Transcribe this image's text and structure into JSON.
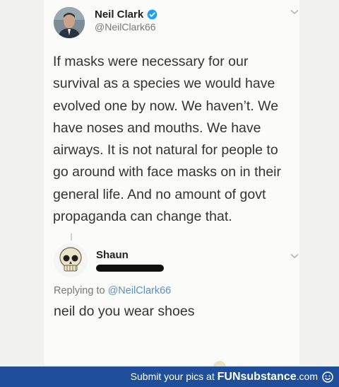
{
  "tweet": {
    "author_name": "Neil Clark",
    "author_handle": "@NeilClark66",
    "verified_icon": "verified-badge-icon",
    "menu_icon": "chevron-down-icon",
    "lines": [
      "If masks were necessary for our",
      "survival as a species we would have",
      "evolved one by now. We haven’t. We",
      "have noses and mouths. We have",
      "airways. It is not natural for people to",
      "go around with face masks on in their",
      "general life. And no amount of govt",
      "propaganda can change that."
    ]
  },
  "reply": {
    "author_name": "Shaun",
    "handle_redacted": true,
    "replying_prefix": "Replying to",
    "replying_mention": "@NeilClark66",
    "text": "neil do you wear shoes",
    "menu_icon": "chevron-down-icon"
  },
  "footer": {
    "prefix": "Submit your pics at",
    "brand": "FUNsubstance",
    "suffix": ".com",
    "logo_icon": "funsubstance-logo-icon",
    "background": "#1f4e9a"
  },
  "colors": {
    "page": "#f1f1f0",
    "card": "#fbfbfa",
    "text": "#333333",
    "muted": "#777777",
    "link": "#5b8fc4",
    "verified": "#1da1f2"
  }
}
